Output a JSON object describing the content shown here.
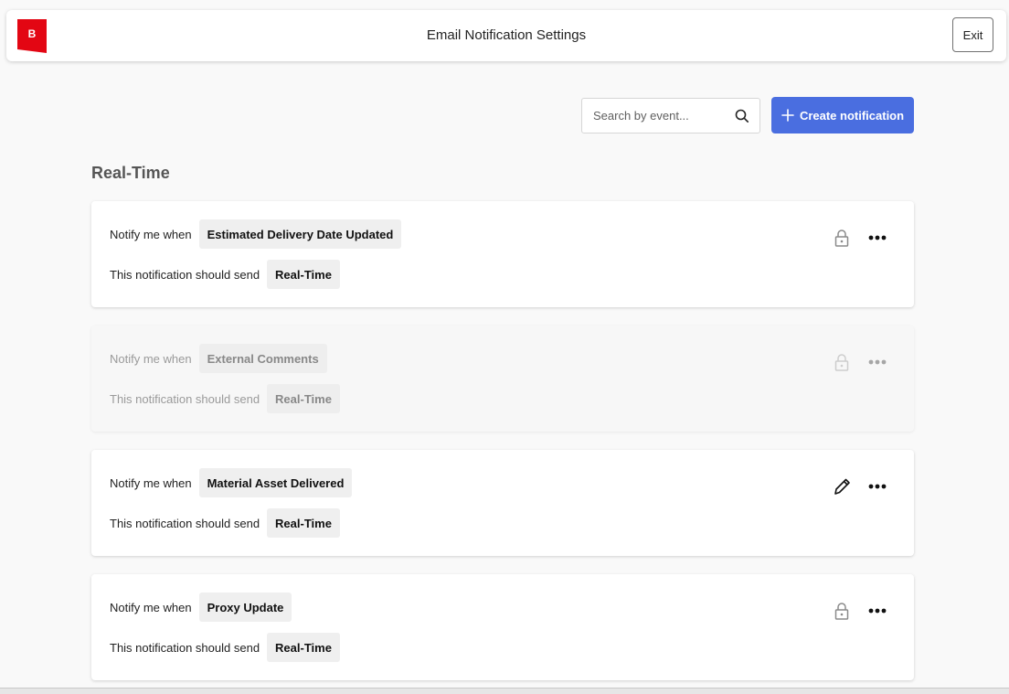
{
  "header": {
    "logo_letter": "B",
    "title": "Email Notification Settings",
    "exit_label": "Exit"
  },
  "toolbar": {
    "search_placeholder": "Search by event...",
    "create_label": "Create notification"
  },
  "section": {
    "title": "Real-Time"
  },
  "notifications": [
    {
      "notify_label": "Notify me when",
      "event": "Estimated Delivery Date Updated",
      "send_label": "This notification should send",
      "frequency": "Real-Time",
      "action_icon": "lock-icon",
      "disabled": false
    },
    {
      "notify_label": "Notify me when",
      "event": "External Comments",
      "send_label": "This notification should send",
      "frequency": "Real-Time",
      "action_icon": "lock-icon",
      "disabled": true
    },
    {
      "notify_label": "Notify me when",
      "event": "Material Asset Delivered",
      "send_label": "This notification should send",
      "frequency": "Real-Time",
      "action_icon": "pencil-icon",
      "disabled": false
    },
    {
      "notify_label": "Notify me when",
      "event": "Proxy Update",
      "send_label": "This notification should send",
      "frequency": "Real-Time",
      "action_icon": "lock-icon",
      "disabled": false
    }
  ],
  "colors": {
    "brand_red": "#e30613",
    "accent_blue": "#4a6ee0",
    "background": "#f9f9f9"
  }
}
